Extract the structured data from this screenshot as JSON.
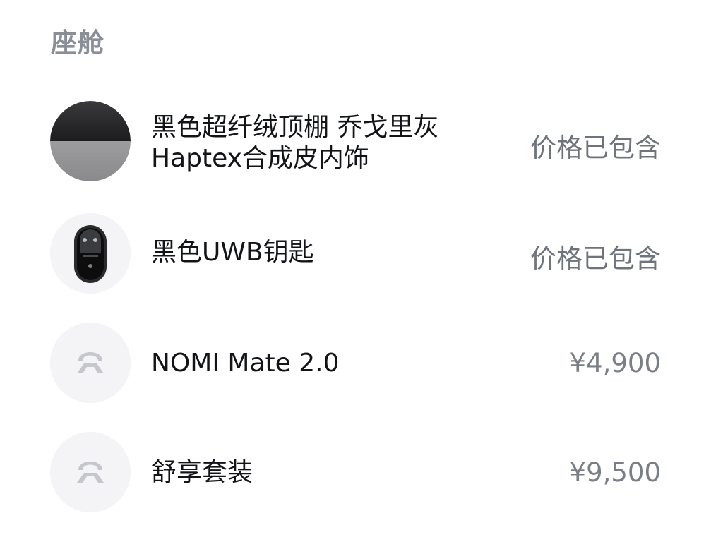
{
  "section": {
    "title": "座舱"
  },
  "items": [
    {
      "icon": "headliner-swatch-icon",
      "name_line1": "黑色超纤绒顶棚 乔戈里灰",
      "name_line2": "Haptex合成皮内饰",
      "price": "价格已包含"
    },
    {
      "icon": "uwb-key-icon",
      "name_line1": "黑色UWB钥匙",
      "price": "价格已包含"
    },
    {
      "icon": "nio-logo-icon",
      "name_line1": "NOMI Mate 2.0",
      "price": "¥4,900"
    },
    {
      "icon": "nio-logo-icon",
      "name_line1": "舒享套装",
      "price": "¥9,500"
    }
  ],
  "colors": {
    "title": "#8a8e96",
    "text": "#121418",
    "price": "#6f737b",
    "thumb_bg": "#f4f4f6",
    "logo": "#c5c7cc"
  }
}
